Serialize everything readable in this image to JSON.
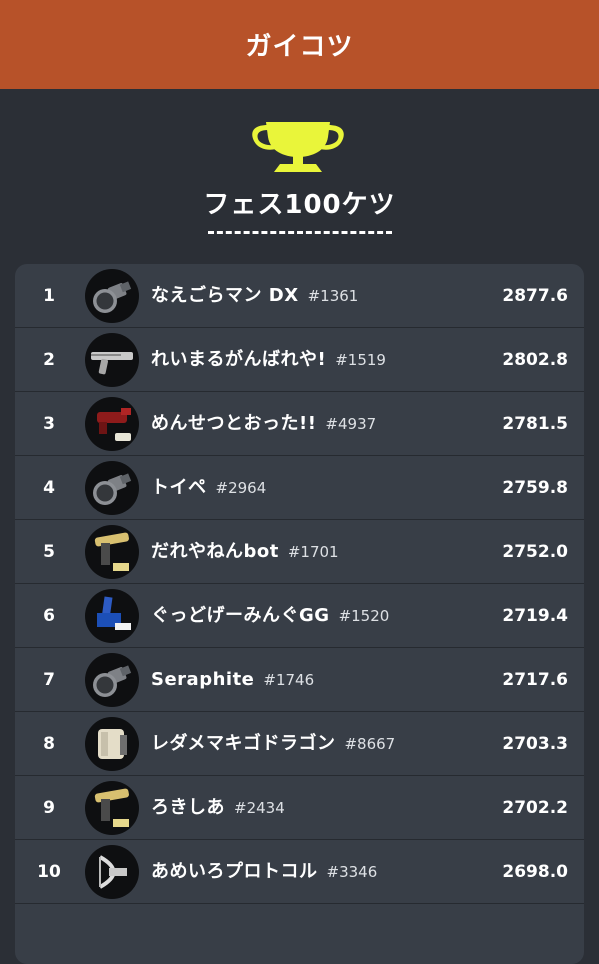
{
  "header": {
    "title": "ガイコツ"
  },
  "ranking": {
    "title": "フェス100ケツ",
    "trophy_color": "#e9f53a"
  },
  "players": [
    {
      "rank": "1",
      "name": "なえごらマン DX",
      "tag": "#1361",
      "score": "2877.6",
      "weapon": "roller-icon"
    },
    {
      "rank": "2",
      "name": "れいまるがんばれや!",
      "tag": "#1519",
      "score": "2802.8",
      "weapon": "charger-icon"
    },
    {
      "rank": "3",
      "name": "めんせつとおった!!",
      "tag": "#4937",
      "score": "2781.5",
      "weapon": "shooter-icon"
    },
    {
      "rank": "4",
      "name": "トイペ",
      "tag": "#2964",
      "score": "2759.8",
      "weapon": "roller-icon"
    },
    {
      "rank": "5",
      "name": "だれやねんbot",
      "tag": "#1701",
      "score": "2752.0",
      "weapon": "splatling-icon"
    },
    {
      "rank": "6",
      "name": "ぐっどげーみんぐGG",
      "tag": "#1520",
      "score": "2719.4",
      "weapon": "brush-icon"
    },
    {
      "rank": "7",
      "name": "Seraphite",
      "tag": "#1746",
      "score": "2717.6",
      "weapon": "roller-icon"
    },
    {
      "rank": "8",
      "name": "レダメマキゴドラゴン",
      "tag": "#8667",
      "score": "2703.3",
      "weapon": "brella-icon"
    },
    {
      "rank": "9",
      "name": "ろきしあ",
      "tag": "#2434",
      "score": "2702.2",
      "weapon": "splatling-icon"
    },
    {
      "rank": "10",
      "name": "あめいろプロトコル",
      "tag": "#3346",
      "score": "2698.0",
      "weapon": "stringer-icon"
    }
  ]
}
